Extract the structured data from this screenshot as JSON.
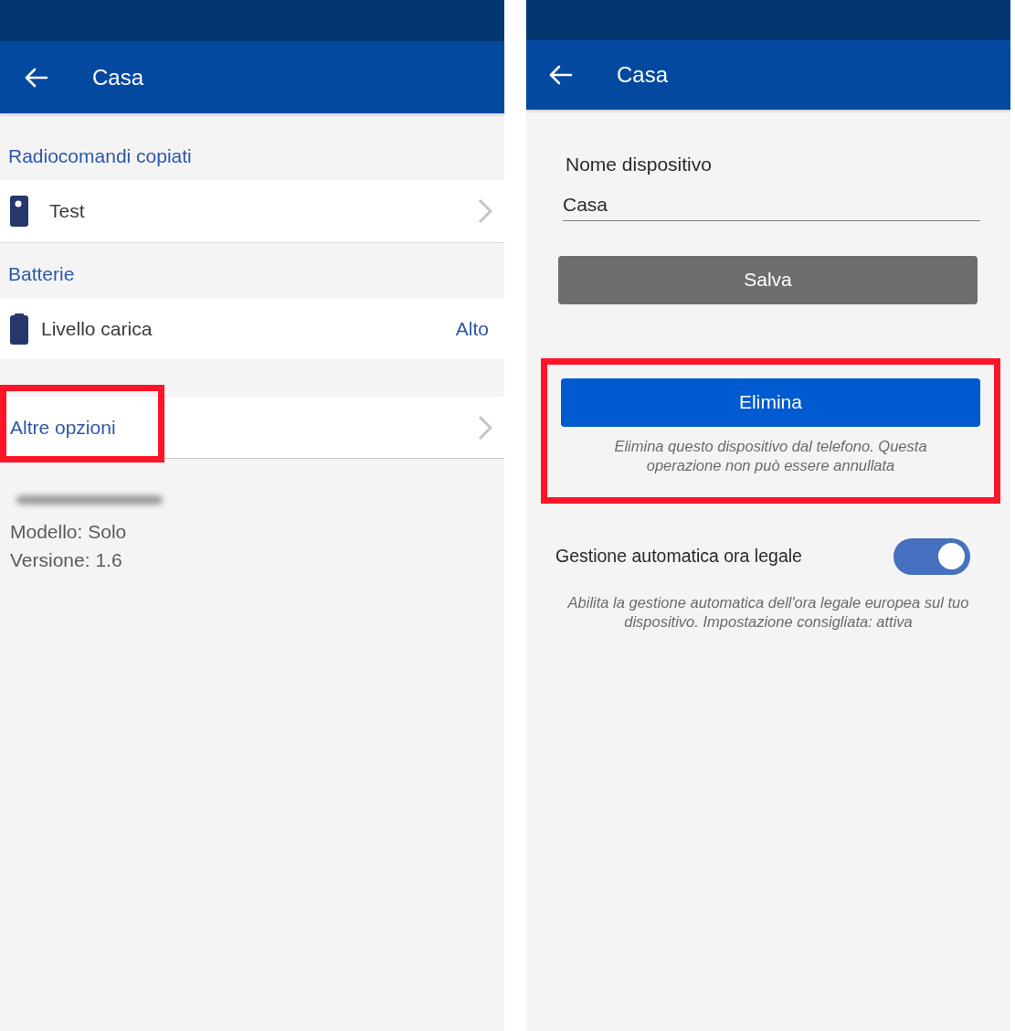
{
  "left_screen": {
    "header": {
      "title": "Casa"
    },
    "sections": [
      {
        "heading": "Radiocomandi copiati",
        "rows": [
          {
            "kind": "remote",
            "label": "Test"
          }
        ]
      },
      {
        "heading": "Batterie",
        "rows": [
          {
            "kind": "battery",
            "label": "Livello carica",
            "value": "Alto"
          }
        ]
      }
    ],
    "more_options": {
      "label": "Altre opzioni",
      "highlighted": true
    },
    "info": [
      "Modello: Solo",
      "Versione: 1.6"
    ]
  },
  "right_screen": {
    "header": {
      "title": "Casa"
    },
    "name_field": {
      "label": "Nome dispositivo",
      "value": "Casa"
    },
    "save_button": "Salva",
    "delete": {
      "button": "Elimina",
      "note": "Elimina questo dispositivo dal telefono. Questa operazione non può essere annullata",
      "highlighted": true
    },
    "toggle": {
      "label": "Gestione automatica ora legale",
      "on": true,
      "note": "Abilita la gestione automatica dell'ora legale europea sul tuo dispositivo. Impostazione consigliata: attiva"
    }
  }
}
